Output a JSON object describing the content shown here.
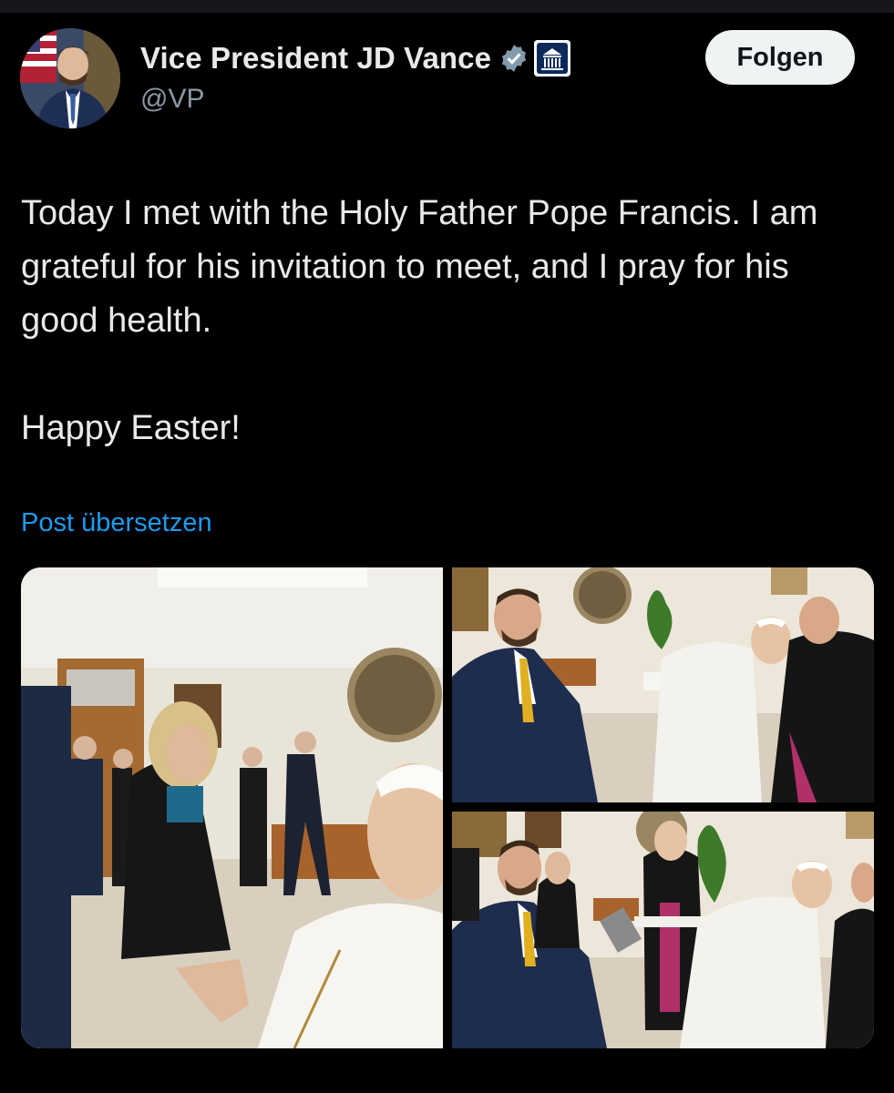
{
  "post": {
    "author": {
      "display_name": "Vice President JD Vance",
      "handle": "@VP",
      "verified_icon": "verified-badge-icon",
      "affiliation_icon": "white-house-icon"
    },
    "follow_label": "Folgen",
    "text": "Today I met with the Holy Father Pope Francis. I am grateful for his invitation to meet, and I pray for his good health.\n\nHappy Easter!",
    "translate_label": "Post übersetzen",
    "media": [
      {
        "kind": "photo",
        "description_icon": "photo-icon"
      },
      {
        "kind": "photo",
        "description_icon": "photo-icon"
      },
      {
        "kind": "photo",
        "description_icon": "photo-icon"
      }
    ]
  },
  "colors": {
    "background": "#000000",
    "text": "#e7e9ea",
    "secondary_text": "#8b98a5",
    "link": "#1d9bf0",
    "verified": "#829aab",
    "follow_bg": "#eff3f4"
  }
}
